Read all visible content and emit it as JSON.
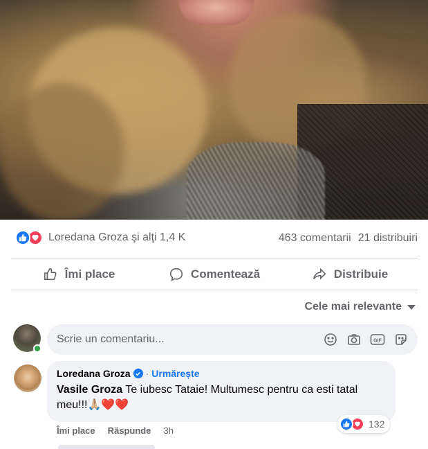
{
  "post": {
    "reactions": {
      "icons": [
        "like-icon",
        "love-icon"
      ],
      "summary": "Loredana Groza şi alţi 1,4 K"
    },
    "comments_count": "463 comentarii",
    "shares_count": "21 distribuiri"
  },
  "actions": {
    "like": "Îmi place",
    "comment": "Comentează",
    "share": "Distribuie"
  },
  "sort": {
    "label": "Cele mai relevante"
  },
  "composer": {
    "placeholder": "Scrie un comentariu...",
    "tools": [
      "emoji-icon",
      "camera-icon",
      "gif-icon",
      "sticker-icon"
    ]
  },
  "comment": {
    "author": "Loredana Groza",
    "verified": true,
    "follow_label": "Urmărește",
    "mention": "Vasile Groza",
    "text": "Te iubesc Tataie! Multumesc pentru ca esti tatal meu!!!🙏🏼❤️❤️",
    "reaction_count": "132",
    "like_label": "Îmi place",
    "reply_label": "Răspunde",
    "time": "3h"
  },
  "colors": {
    "accent": "#1877f2",
    "love": "#f33e58",
    "muted_text": "#65676b",
    "bubble_bg": "#f0f2f5"
  }
}
